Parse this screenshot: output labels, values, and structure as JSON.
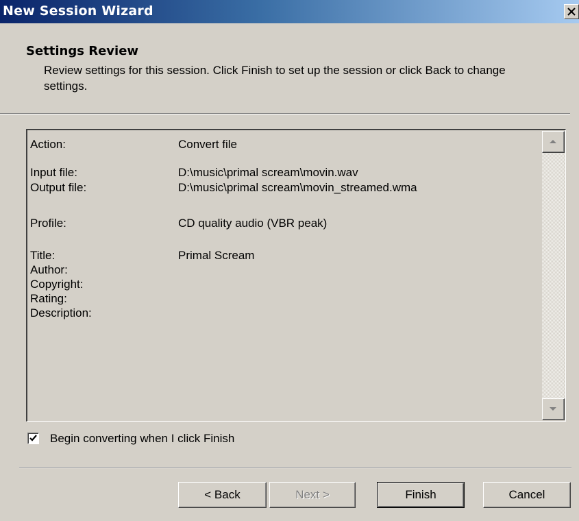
{
  "window": {
    "title": "New Session Wizard"
  },
  "header": {
    "title": "Settings Review",
    "description": "Review settings for this session. Click Finish to set up the session or click Back to change settings."
  },
  "review": {
    "rows": [
      {
        "label": "Action:",
        "value": "Convert file"
      },
      {
        "label": "Input file:",
        "value": "D:\\music\\primal scream\\movin.wav"
      },
      {
        "label": "Output file:",
        "value": "D:\\music\\primal scream\\movin_streamed.wma"
      },
      {
        "label": "Profile:",
        "value": "CD quality audio (VBR peak)"
      },
      {
        "label": "Title:",
        "value": "Primal Scream"
      },
      {
        "label": "Author:",
        "value": ""
      },
      {
        "label": "Copyright:",
        "value": ""
      },
      {
        "label": "Rating:",
        "value": ""
      },
      {
        "label": "Description:",
        "value": ""
      }
    ]
  },
  "options": {
    "begin_converting_label": "Begin converting when I click Finish",
    "begin_converting_checked": true
  },
  "buttons": {
    "back": "< Back",
    "next": "Next >",
    "finish": "Finish",
    "cancel": "Cancel"
  },
  "icons": {
    "close": "close-icon",
    "scroll_up": "arrow-up-icon",
    "scroll_down": "arrow-down-icon",
    "check": "checkmark-icon"
  },
  "colors": {
    "titlebar_start": "#0a246a",
    "titlebar_end": "#a6caf0",
    "face": "#d4d0c8"
  }
}
